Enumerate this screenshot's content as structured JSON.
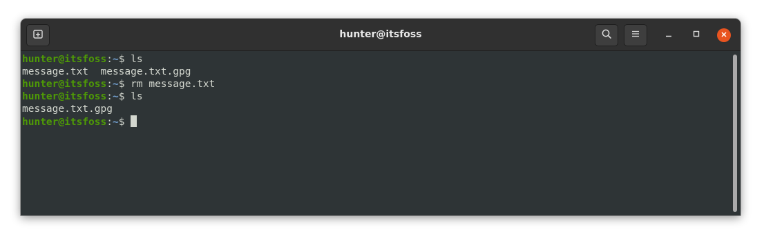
{
  "window": {
    "title": "hunter@itsfoss"
  },
  "headerbar": {
    "new_tab_icon": "new-tab-icon",
    "search_icon": "search-icon",
    "menu_icon": "hamburger-menu-icon",
    "minimize_icon": "minimize-icon",
    "maximize_icon": "maximize-icon",
    "close_icon": "close-icon",
    "close_color": "#e95420"
  },
  "terminal": {
    "prompt_user": "hunter@itsfoss",
    "prompt_sep": ":",
    "prompt_path": "~",
    "prompt_symbol": "$ ",
    "lines": [
      {
        "type": "prompt",
        "command": "ls"
      },
      {
        "type": "output",
        "text": "message.txt  message.txt.gpg"
      },
      {
        "type": "prompt",
        "command": "rm message.txt"
      },
      {
        "type": "prompt",
        "command": "ls"
      },
      {
        "type": "output",
        "text": "message.txt.gpg"
      },
      {
        "type": "prompt",
        "command": ""
      }
    ],
    "colors": {
      "background": "#2e3436",
      "text": "#d3d7cf",
      "user": "#4e9a06",
      "path": "#729fcf"
    }
  }
}
